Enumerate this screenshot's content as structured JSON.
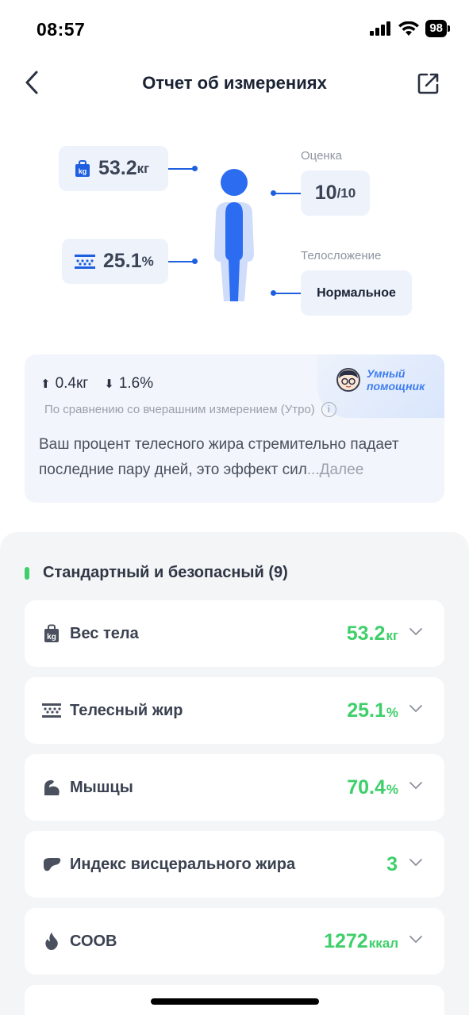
{
  "status_bar": {
    "time": "08:57",
    "battery": "98"
  },
  "header": {
    "title": "Отчет об измерениях"
  },
  "summary": {
    "weight_value": "53.2",
    "weight_unit": "кг",
    "fat_value": "25.1",
    "fat_unit": "%",
    "score_label": "Оценка",
    "score_value": "10",
    "score_max": "/10",
    "build_label": "Телосложение",
    "build_value": "Нормальное"
  },
  "assistant": {
    "name": "Умный помощник",
    "delta_weight": "0.4кг",
    "delta_fat": "1.6%",
    "compare_text": "По сравнению со вчерашним измерением (Утро)",
    "advice": "Ваш процент телесного жира стремительно падает последние пару дней, это эффект сил",
    "more": "...Далее"
  },
  "section": {
    "title": "Стандартный и безопасный (9)",
    "accent": "#3ecf6a"
  },
  "metrics": [
    {
      "label": "Вес тела",
      "value": "53.2",
      "unit": "кг",
      "icon": "weight-icon"
    },
    {
      "label": "Телесный жир",
      "value": "25.1",
      "unit": "%",
      "icon": "body-fat-icon"
    },
    {
      "label": "Мышцы",
      "value": "70.4",
      "unit": "%",
      "icon": "muscle-icon"
    },
    {
      "label": "Индекс висцерального жира",
      "value": "3",
      "unit": "",
      "icon": "organ-icon"
    },
    {
      "label": "СООВ",
      "value": "1272",
      "unit": "ккал",
      "icon": "flame-icon"
    }
  ],
  "colors": {
    "accent_blue": "#1e5fe0",
    "value_green": "#3ecf6a"
  }
}
